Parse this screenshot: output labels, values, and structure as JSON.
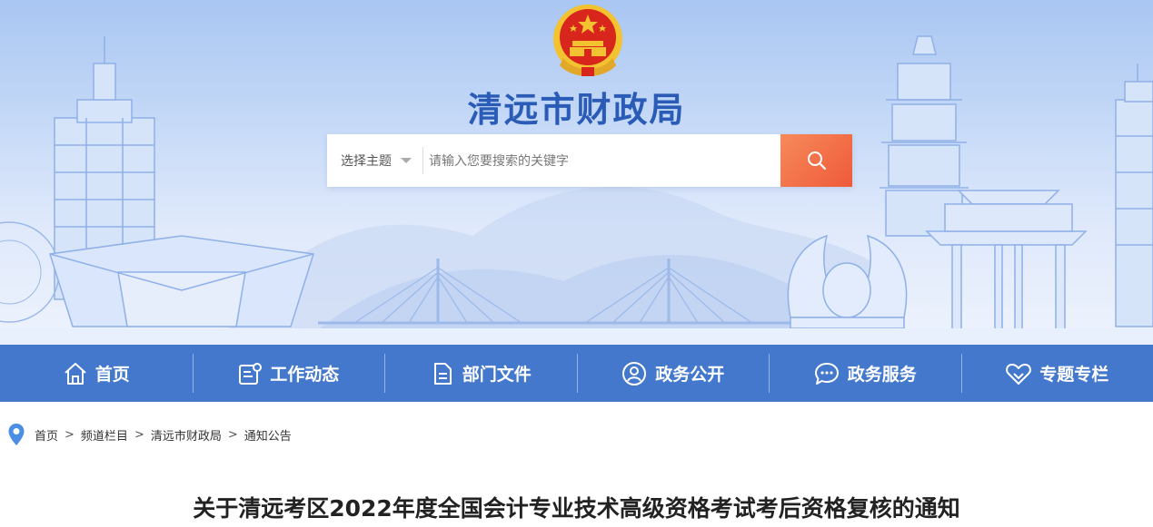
{
  "site": {
    "title": "清远市财政局"
  },
  "search": {
    "topic_label": "选择主题",
    "placeholder": "请输入您要搜索的关键字"
  },
  "nav": {
    "items": [
      {
        "label": "首页",
        "icon": "home-icon"
      },
      {
        "label": "工作动态",
        "icon": "news-icon"
      },
      {
        "label": "部门文件",
        "icon": "document-icon"
      },
      {
        "label": "政务公开",
        "icon": "user-icon"
      },
      {
        "label": "政务服务",
        "icon": "chat-icon"
      },
      {
        "label": "专题专栏",
        "icon": "heart-icon"
      }
    ]
  },
  "breadcrumb": {
    "items": [
      "首页",
      "频道栏目",
      "清远市财政局",
      "通知公告"
    ],
    "separator": ">"
  },
  "article": {
    "title": "关于清远考区2022年度全国会计专业技术高级资格考试考后资格复核的通知"
  },
  "colors": {
    "nav_bg": "#4378cc",
    "title_blue": "#2a5cb7",
    "search_btn": "#ee5a3a",
    "emblem_red": "#d8261c",
    "emblem_gold": "#f2c230"
  }
}
